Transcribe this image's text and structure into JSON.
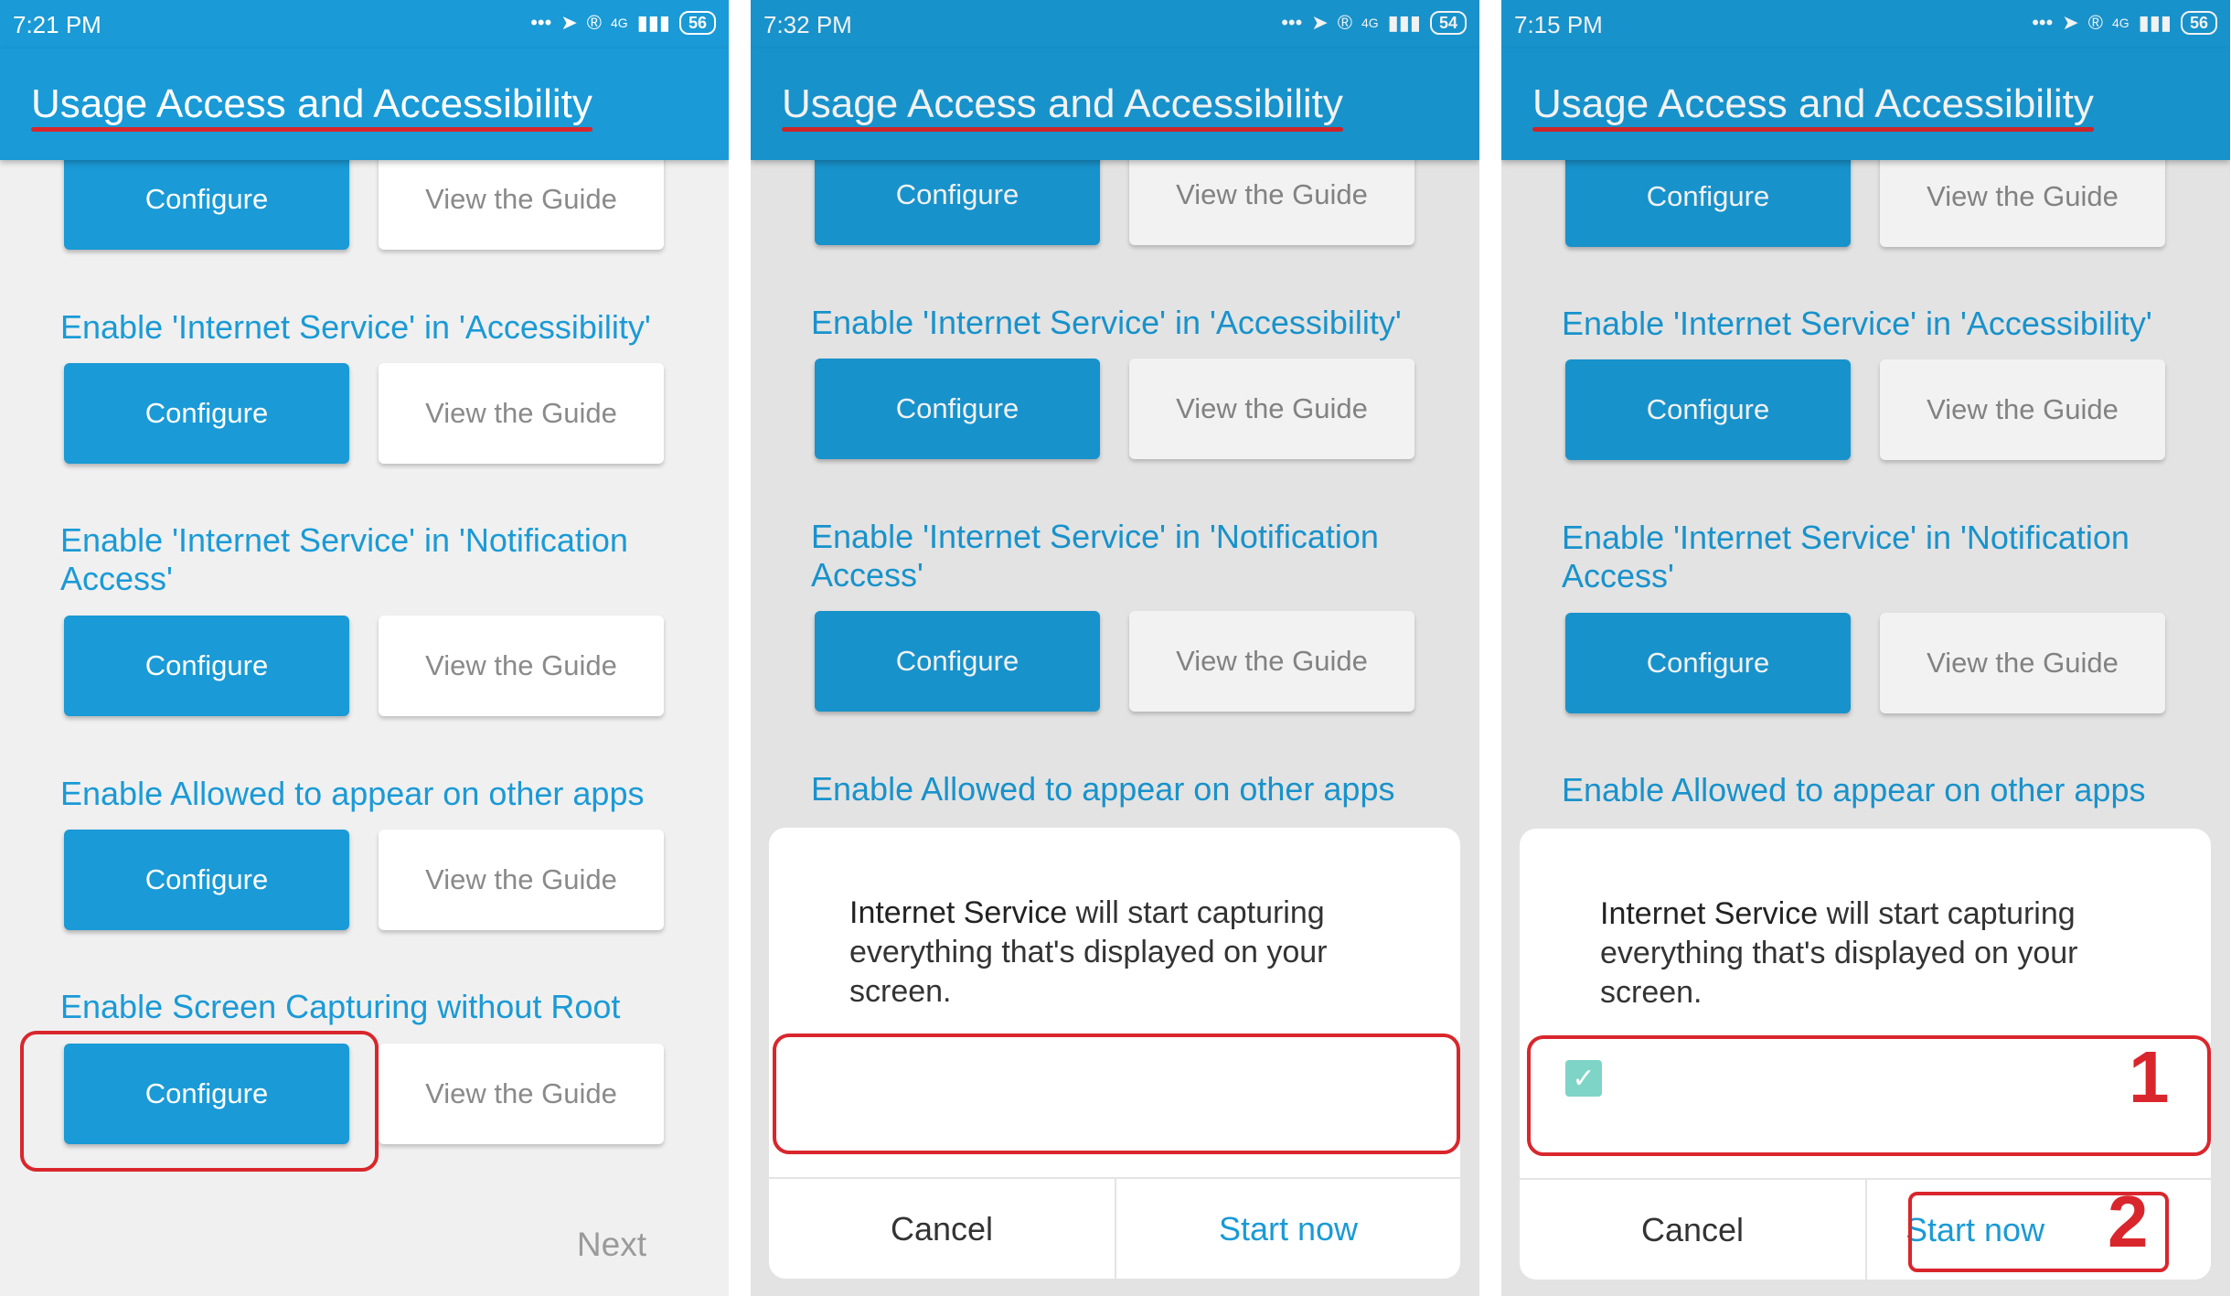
{
  "colors": {
    "primary": "#1a9ad6",
    "annotation_red": "#d9262c",
    "checkbox": "#7fd4c8",
    "background": "#f0f0f0"
  },
  "screens": [
    {
      "status": {
        "time": "7:21 PM",
        "network": "4G",
        "battery": "56"
      },
      "title": "Usage Access and Accessibility",
      "sections": [
        {
          "title": "",
          "configure": "Configure",
          "guide": "View the Guide"
        },
        {
          "title": "Enable 'Internet Service' in 'Accessibility'",
          "configure": "Configure",
          "guide": "View the Guide"
        },
        {
          "title": "Enable 'Internet Service' in 'Notification Access'",
          "configure": "Configure",
          "guide": "View the Guide"
        },
        {
          "title": "Enable Allowed to appear on other apps",
          "configure": "Configure",
          "guide": "View the Guide"
        },
        {
          "title": "Enable Screen Capturing without Root",
          "configure": "Configure",
          "guide": "View the Guide"
        }
      ],
      "next": "Next"
    },
    {
      "status": {
        "time": "7:32 PM",
        "network": "4G",
        "battery": "54"
      },
      "title": "Usage Access and Accessibility",
      "sections": [
        {
          "title": "",
          "configure": "Configure",
          "guide": "View the Guide"
        },
        {
          "title": "Enable 'Internet Service' in 'Accessibility'",
          "configure": "Configure",
          "guide": "View the Guide"
        },
        {
          "title": "Enable 'Internet Service' in 'Notification Access'",
          "configure": "Configure",
          "guide": "View the Guide"
        },
        {
          "title": "Enable Allowed to appear on other apps"
        }
      ],
      "dialog": {
        "app_name": "Internet  Service",
        "message": " will start capturing everything that's displayed on your screen.",
        "cancel": "Cancel",
        "start": "Start  now"
      }
    },
    {
      "status": {
        "time": "7:15 PM",
        "network": "4G",
        "battery": "56"
      },
      "title": "Usage Access and Accessibility",
      "sections": [
        {
          "title": "",
          "configure": "Configure",
          "guide": "View the Guide"
        },
        {
          "title": "Enable 'Internet Service' in 'Accessibility'",
          "configure": "Configure",
          "guide": "View the Guide"
        },
        {
          "title": "Enable 'Internet Service' in 'Notification Access'",
          "configure": "Configure",
          "guide": "View the Guide"
        },
        {
          "title": "Enable Allowed to appear on other apps"
        }
      ],
      "dialog": {
        "app_name": "Internet  Service",
        "message": " will start capturing everything that's displayed on your screen.",
        "cancel": "Cancel",
        "start": "Start  now",
        "checkbox_checked": true
      },
      "steps": [
        "1",
        "2"
      ]
    }
  ]
}
